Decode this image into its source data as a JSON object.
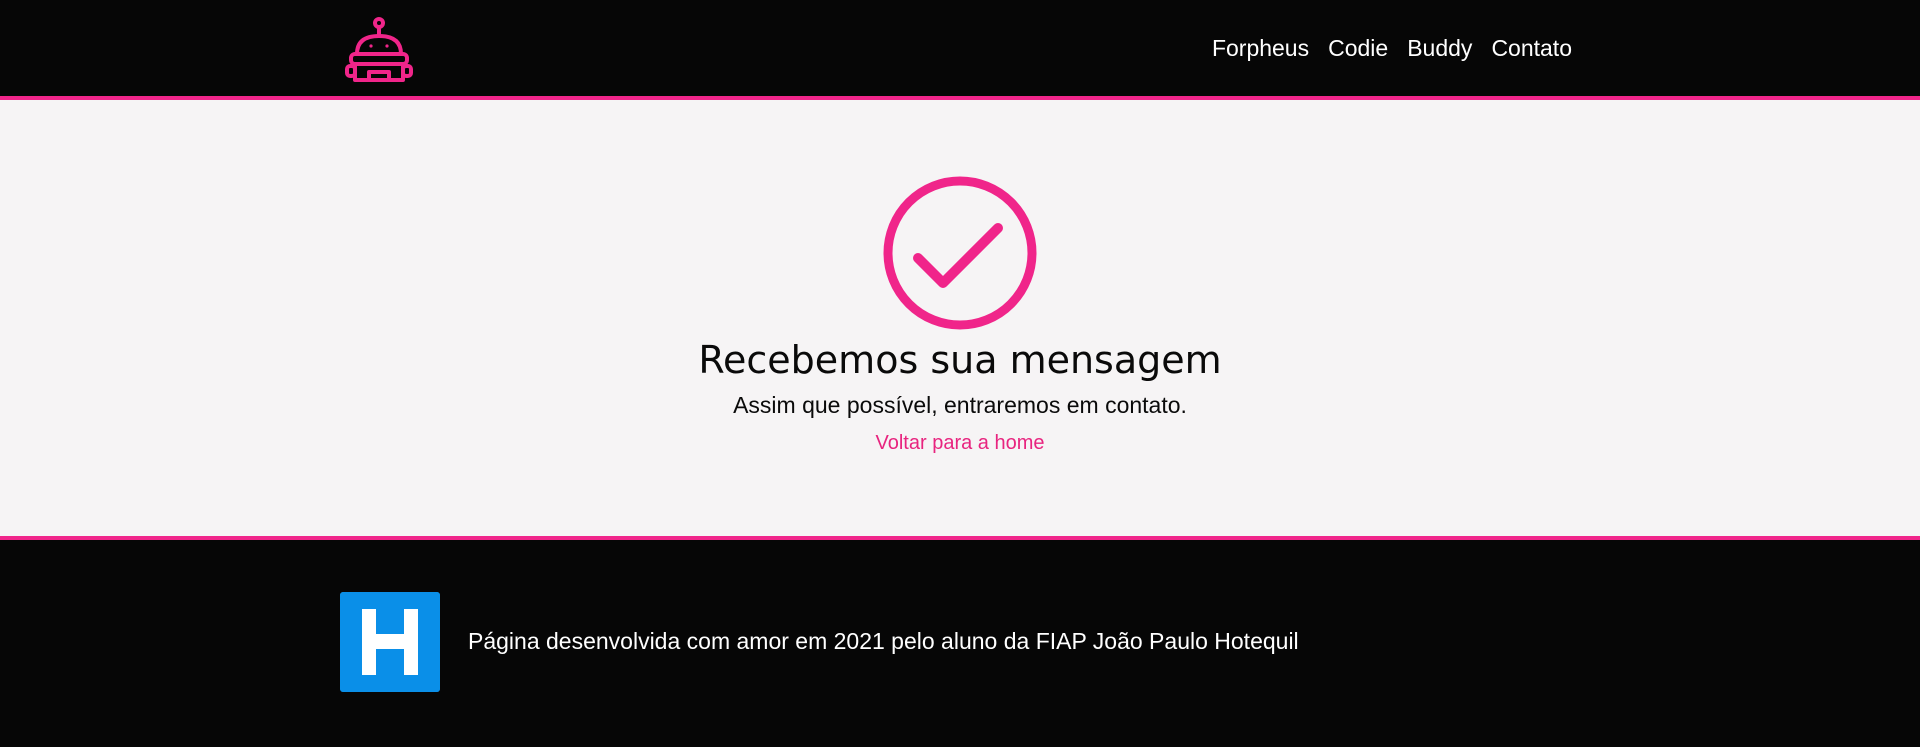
{
  "header": {
    "logo_icon": "robot-icon",
    "nav": [
      {
        "label": "Forpheus"
      },
      {
        "label": "Codie"
      },
      {
        "label": "Buddy"
      },
      {
        "label": "Contato"
      }
    ]
  },
  "main": {
    "status_icon": "check-circle-icon",
    "title": "Recebemos sua mensagem",
    "subtitle": "Assim que possível, entraremos em contato.",
    "back_link": "Voltar para a home"
  },
  "footer": {
    "logo_icon": "h-logo-icon",
    "logo_letter": "H",
    "text": "Página desenvolvida com amor em 2021 pelo aluno da FIAP João Paulo Hotequil"
  },
  "colors": {
    "accent": "#f0258a",
    "header_bg": "#060606",
    "main_bg": "#f6f4f5",
    "footer_logo_bg": "#0a8fe8"
  }
}
